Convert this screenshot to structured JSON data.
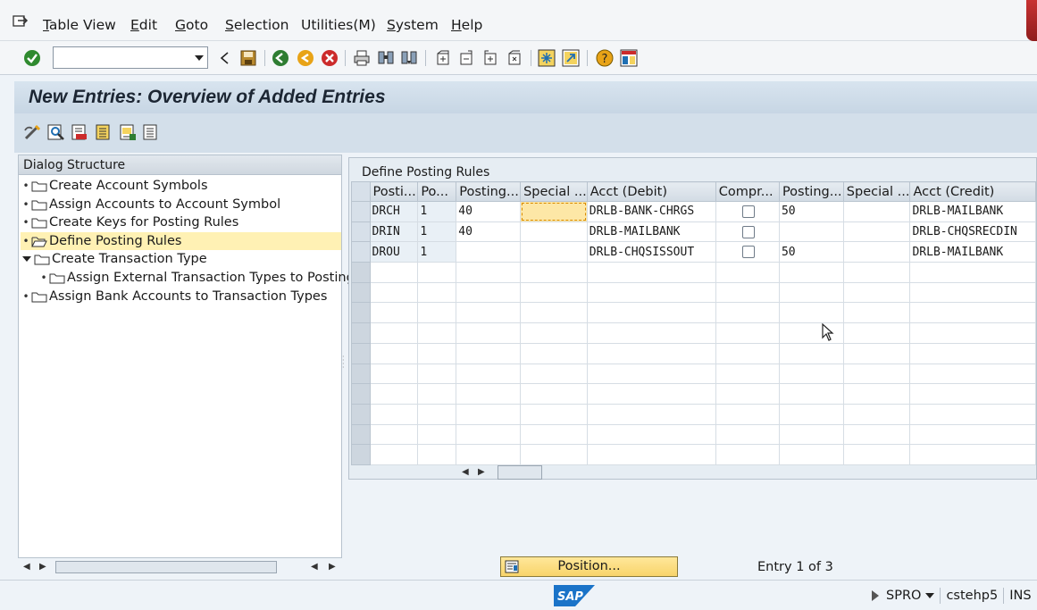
{
  "menu": {
    "items": [
      {
        "label": "Table View",
        "underline": "T",
        "rest": "able View"
      },
      {
        "label": "Edit",
        "underline": "E",
        "rest": "dit"
      },
      {
        "label": "Goto",
        "underline": "G",
        "rest": "oto"
      },
      {
        "label": "Selection",
        "underline": "S",
        "rest": "election"
      },
      {
        "label": "Utilities(M)",
        "underline": "",
        "rest": "Utilities(M)"
      },
      {
        "label": "System",
        "underline": "S",
        "rest": "ystem"
      },
      {
        "label": "Help",
        "underline": "H",
        "rest": "elp"
      }
    ]
  },
  "toolbar": {
    "command_value": "",
    "icons": [
      "enter-icon",
      "back-icon",
      "save-icon",
      "back-nav-icon",
      "exit-icon",
      "cancel-icon",
      "print-icon",
      "find-icon",
      "find-next-icon",
      "first-page-icon",
      "previous-page-icon",
      "next-page-icon",
      "last-page-icon",
      "create-session-icon",
      "shortcut-icon",
      "help-icon",
      "layout-icon"
    ]
  },
  "title": "New Entries: Overview of Added Entries",
  "dialog_structure": {
    "header": "Dialog Structure",
    "nodes": [
      {
        "label": "Create Account Symbols",
        "level": 0,
        "expanded": false,
        "selected": false
      },
      {
        "label": "Assign Accounts to Account Symbol",
        "level": 0,
        "expanded": false,
        "selected": false
      },
      {
        "label": "Create Keys for Posting Rules",
        "level": 0,
        "expanded": false,
        "selected": false
      },
      {
        "label": "Define Posting Rules",
        "level": 0,
        "expanded": false,
        "selected": true
      },
      {
        "label": "Create Transaction Type",
        "level": 0,
        "expanded": true,
        "selected": false
      },
      {
        "label": "Assign External Transaction Types to Posting",
        "level": 1,
        "expanded": false,
        "selected": false
      },
      {
        "label": "Assign Bank Accounts to Transaction Types",
        "level": 0,
        "expanded": false,
        "selected": false
      }
    ]
  },
  "table": {
    "caption": "Define Posting Rules",
    "columns": [
      "Posti...",
      "Po...",
      "Posting...",
      "Special ...",
      "Acct (Debit)",
      "Compr...",
      "Posting...",
      "Special ...",
      "Acct (Credit)"
    ],
    "rows": [
      [
        "DRCH",
        "1",
        "40",
        "",
        "DRLB-BANK-CHRGS",
        "",
        "50",
        "",
        "DRLB-MAILBANK"
      ],
      [
        "DRIN",
        "1",
        "40",
        "",
        "DRLB-MAILBANK",
        "",
        "",
        "",
        "DRLB-CHQSRECDIN"
      ],
      [
        "DROU",
        "1",
        "",
        "",
        "DRLB-CHQSISSOUT",
        "",
        "50",
        "",
        "DRLB-MAILBANK"
      ]
    ],
    "empty_rows": 10
  },
  "position_button": "Position...",
  "entry_info": "Entry 1 of 3",
  "status": {
    "transaction": "SPRO",
    "server": "cstehp5",
    "mode": "INS"
  },
  "colors": {
    "accent_yellow": "#f8d46a",
    "selection": "#fff1b4",
    "header_blue": "#c7d6e4"
  }
}
